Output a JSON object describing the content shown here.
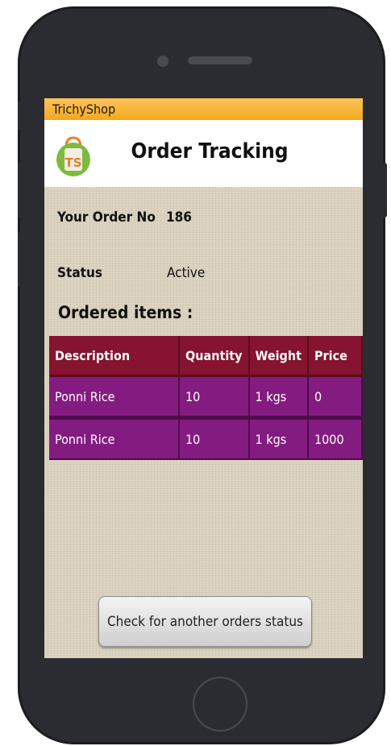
{
  "app": {
    "name": "TrichyShop"
  },
  "header": {
    "title": "Order Tracking",
    "logo_text": "TS"
  },
  "order": {
    "label": "Your Order No",
    "number": "186",
    "status_label": "Status",
    "status_value": "Active"
  },
  "items_section": {
    "title": "Ordered  items  :"
  },
  "table": {
    "columns": [
      "Description",
      "Quantity",
      "Weight",
      "Price"
    ],
    "rows": [
      [
        "Ponni Rice",
        "10",
        "1 kgs",
        "0"
      ],
      [
        "Ponni Rice",
        "10",
        "1 kgs",
        "1000"
      ]
    ]
  },
  "cta": {
    "label": "Check for another orders status"
  },
  "colors": {
    "titlebar": "#f3a91e",
    "table_header": "#86132f",
    "table_row": "#841b80",
    "phone_frame": "#2b2c31"
  }
}
